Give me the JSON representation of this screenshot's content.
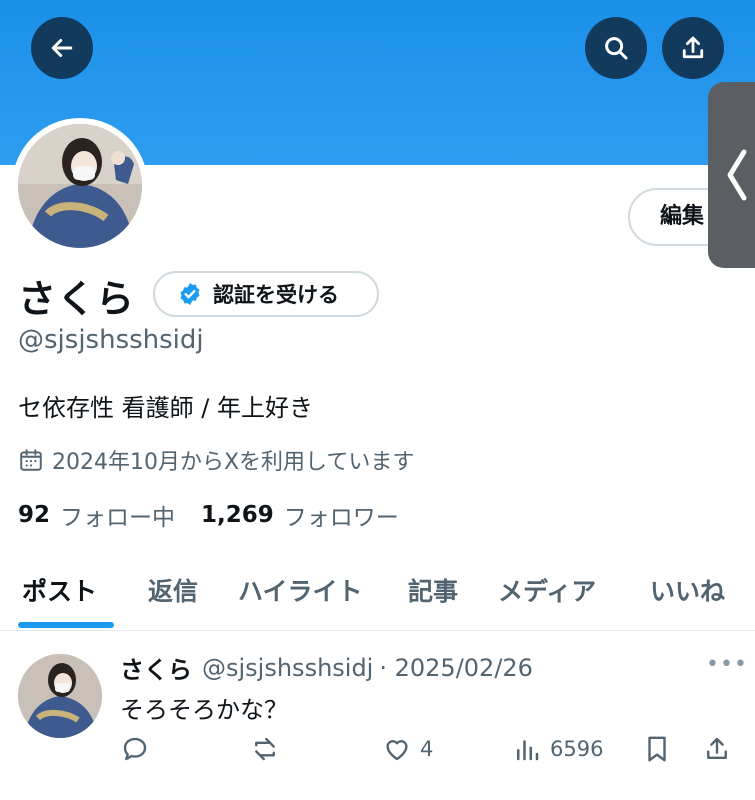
{
  "profile": {
    "name": "さくら",
    "verify_label": "認証を受ける",
    "handle": "@sjsjshsshsidj",
    "bio": "セ依存性 看護師 / 年上好き",
    "joined": "2024年10月からXを利用しています",
    "edit_label": "編集",
    "following_count": "92",
    "following_label": "フォロー中",
    "followers_count": "1,269",
    "followers_label": "フォロワー"
  },
  "tabs": [
    "ポスト",
    "返信",
    "ハイライト",
    "記事",
    "メディア",
    "いいね"
  ],
  "post": {
    "name": "さくら",
    "handle": "@sjsjshsshsidj",
    "date": "· 2025/02/26",
    "text": "そろそろかな？",
    "likes": "4",
    "views": "6596",
    "more": "•••"
  },
  "colors": {
    "banner": "#1d9bf0",
    "accent": "#1d9bf0",
    "text": "#0f1419",
    "muted": "#536471"
  },
  "icons": [
    "back-arrow-icon",
    "search-icon",
    "share-icon",
    "verified-badge-icon",
    "calendar-icon",
    "reply-icon",
    "repost-icon",
    "like-icon",
    "views-icon",
    "bookmark-icon",
    "share-icon"
  ]
}
